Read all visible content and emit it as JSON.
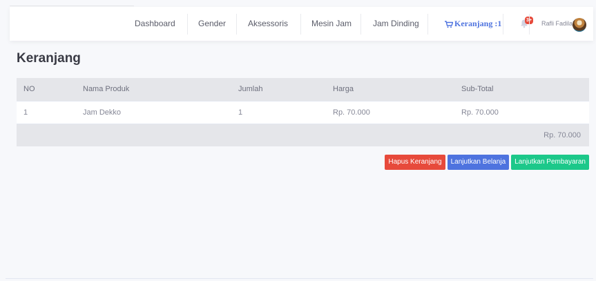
{
  "nav": {
    "items": [
      "Dashboard",
      "Gender",
      "Aksessoris",
      "Mesin Jam",
      "Jam Dinding"
    ],
    "cart_label": "Keranjang :1",
    "notification_badge": "3+",
    "user_name": "Rafli Fadilah"
  },
  "page": {
    "title": "Keranjang"
  },
  "table": {
    "headers": [
      "NO",
      "Nama Produk",
      "Jumlah",
      "Harga",
      "Sub-Total"
    ],
    "rows": [
      [
        "1",
        "Jam Dekko",
        "1",
        "Rp. 70.000",
        "Rp. 70.000"
      ]
    ],
    "total": "Rp. 70.000"
  },
  "actions": {
    "clear_cart": "Hapus Keranjang",
    "continue_shopping": "Lanjutkan Belanja",
    "checkout": "Lanjutkan Pembayaran"
  },
  "colors": {
    "accent": "#4e73df",
    "danger": "#e74a3b",
    "success": "#1cc88a"
  },
  "icons": [
    "shopping-cart-icon",
    "bell-icon",
    "user-avatar"
  ]
}
